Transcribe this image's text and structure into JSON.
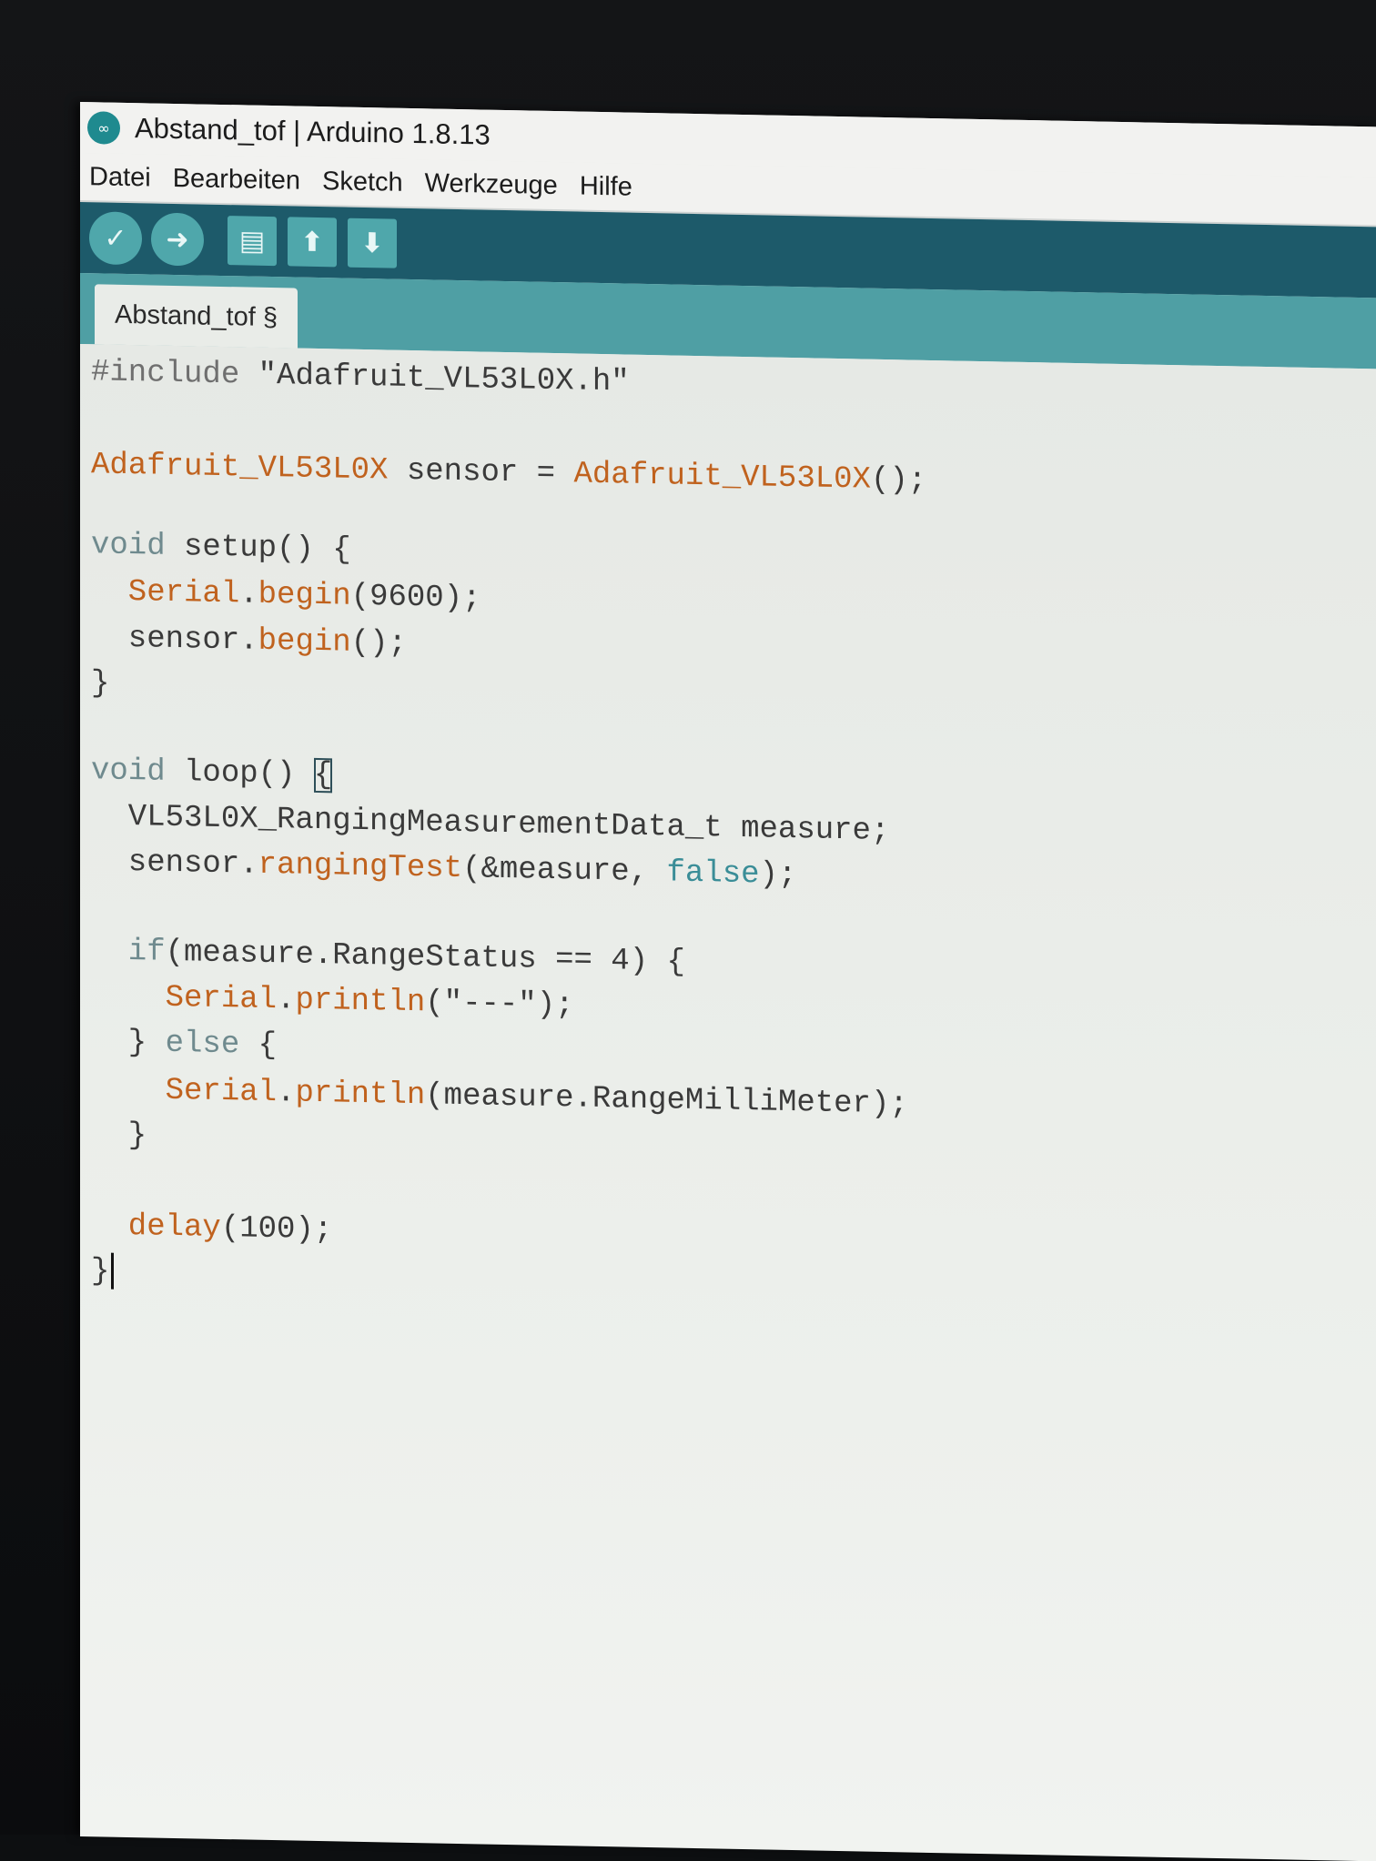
{
  "window": {
    "app_icon": "∞",
    "title": "Abstand_tof | Arduino 1.8.13"
  },
  "menu": {
    "items": [
      "Datei",
      "Bearbeiten",
      "Sketch",
      "Werkzeuge",
      "Hilfe"
    ]
  },
  "toolbar": {
    "verify_icon": "✓",
    "upload_icon": "➜",
    "new_icon": "▤",
    "open_icon": "⬆",
    "save_icon": "⬇"
  },
  "tabs": [
    {
      "label": "Abstand_tof §"
    }
  ],
  "code": {
    "l1_kw": "#include",
    "l1_str": " \"Adafruit_VL53L0X.h\"",
    "l3_type": "Adafruit_VL53L0X",
    "l3_mid": " sensor = ",
    "l3_ctor": "Adafruit_VL53L0X",
    "l3_end": "();",
    "l5_kw": "void",
    "l5_rest": " setup() {",
    "l6_obj": "  Serial",
    "l6_dot": ".",
    "l6_fn": "begin",
    "l6_rest": "(9600);",
    "l7_obj": "  sensor.",
    "l7_fn": "begin",
    "l7_rest": "();",
    "l8": "}",
    "l10_kw": "void",
    "l10_rest": " loop() ",
    "l10_brace": "{",
    "l11": "  VL53L0X_RangingMeasurementData_t measure;",
    "l12_obj": "  sensor.",
    "l12_fn": "rangingTest",
    "l12_mid": "(&measure, ",
    "l12_lit": "false",
    "l12_end": ");",
    "l14_kw": "  if",
    "l14_rest": "(measure.RangeStatus == 4) {",
    "l15_obj": "    Serial",
    "l15_dot": ".",
    "l15_fn": "println",
    "l15_rest": "(\"---\");",
    "l16_open": "  } ",
    "l16_kw": "else",
    "l16_rest": " {",
    "l17_obj": "    Serial",
    "l17_dot": ".",
    "l17_fn": "println",
    "l17_rest": "(measure.RangeMilliMeter);",
    "l18": "  }",
    "l20_fn": "  delay",
    "l20_rest": "(100);",
    "l21": "}"
  }
}
